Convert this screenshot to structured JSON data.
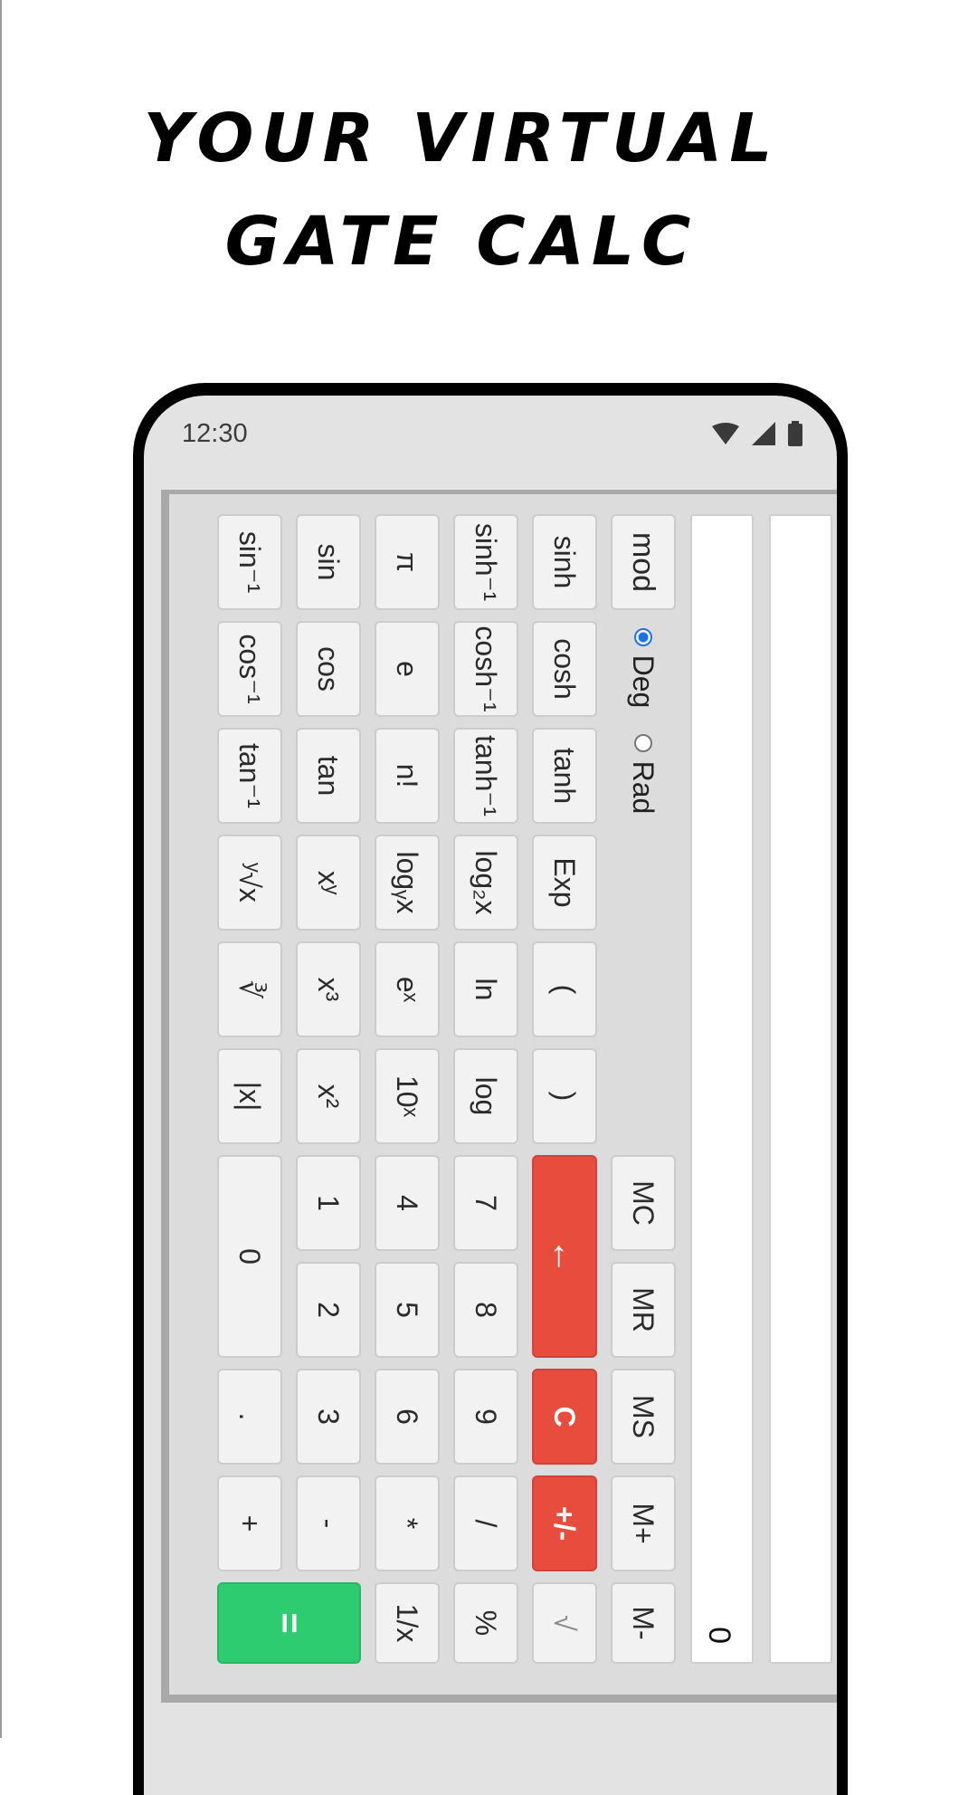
{
  "headline": {
    "line1": "YOUR VIRTUAL",
    "line2": "GATE CALC"
  },
  "status_bar": {
    "time": "12:30",
    "icons": [
      "wifi-icon",
      "signal-icon",
      "battery-icon"
    ]
  },
  "display": {
    "main_value": "0",
    "secondary_value": ""
  },
  "angle_mode": {
    "options": [
      "Deg",
      "Rad"
    ],
    "selected": "Deg"
  },
  "row_top": [
    "mod",
    "sinh",
    "sinh⁻¹",
    "π",
    "sin",
    "sin⁻¹"
  ],
  "row_cos": [
    "cosh",
    "cosh⁻¹",
    "e",
    "cos",
    "cos⁻¹"
  ],
  "row_tan": [
    "tanh",
    "tanh⁻¹",
    "n!",
    "tan",
    "tan⁻¹"
  ],
  "row_log": [
    "Exp",
    "log₂x",
    "logᵧx",
    "xʸ",
    "ʸ√x"
  ],
  "row_ln": [
    "(",
    "ln",
    "eˣ",
    "x³",
    "∛"
  ],
  "row_abs": [
    ")",
    "log",
    "10ˣ",
    "x²",
    "|x|"
  ],
  "memory": [
    "MC",
    "MR",
    "MS",
    "M+",
    "M-"
  ],
  "control": {
    "backspace": "←",
    "clear": "C",
    "negate": "+/-",
    "sqrt": "√"
  },
  "digits": {
    "7": "7",
    "8": "8",
    "9": "9",
    "4": "4",
    "5": "5",
    "6": "6",
    "1": "1",
    "2": "2",
    "3": "3",
    "0": "0"
  },
  "ops": {
    "divide": "/",
    "multiply": "*",
    "subtract": "-",
    "add": "+",
    "dot": ".",
    "percent": "%",
    "reciprocal": "1/x",
    "equals": "="
  },
  "colors": {
    "red": "#e74c3c",
    "green": "#2ecc71",
    "key_bg": "#f2f2f2",
    "panel": "#dcdcdc"
  }
}
